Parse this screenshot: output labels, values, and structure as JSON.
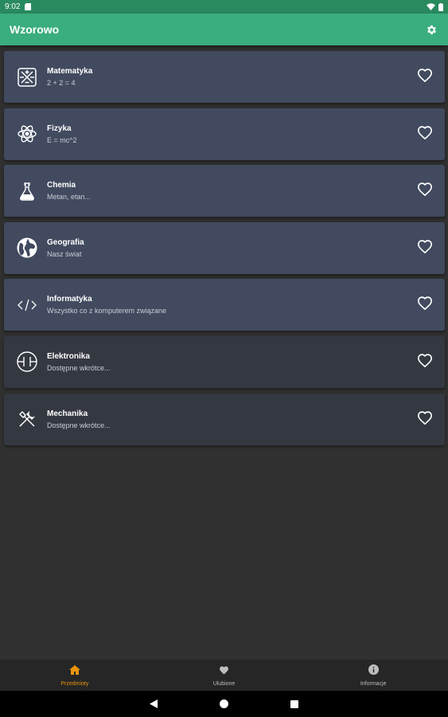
{
  "status_bar": {
    "time": "9:02"
  },
  "app_bar": {
    "title": "Wzorowo"
  },
  "subjects": [
    {
      "name": "Matematyka",
      "desc": "2 + 2 = 4",
      "icon": "calculator-icon",
      "state": "active"
    },
    {
      "name": "Fizyka",
      "desc": "E = mc^2",
      "icon": "atom-icon",
      "state": "active"
    },
    {
      "name": "Chemia",
      "desc": "Metan, etan...",
      "icon": "flask-icon",
      "state": "active"
    },
    {
      "name": "Geografia",
      "desc": "Nasz świat",
      "icon": "globe-icon",
      "state": "active"
    },
    {
      "name": "Informatyka",
      "desc": "Wszystko co z komputerem związane",
      "icon": "code-icon",
      "state": "active"
    },
    {
      "name": "Elektronika",
      "desc": "Dostępne wkrótce...",
      "icon": "circuit-icon",
      "state": "soon"
    },
    {
      "name": "Mechanika",
      "desc": "Dostępne wkrótce...",
      "icon": "tools-icon",
      "state": "soon"
    }
  ],
  "bottom_nav": [
    {
      "label": "Przedmioty",
      "icon": "home-icon",
      "selected": true
    },
    {
      "label": "Ulubione",
      "icon": "heart-icon",
      "selected": false
    },
    {
      "label": "Informacje",
      "icon": "info-icon",
      "selected": false
    }
  ],
  "colors": {
    "accent": "#3aad7e",
    "selected_nav": "#e8940c",
    "card_active": "#414a5f",
    "card_soon": "#343841"
  }
}
